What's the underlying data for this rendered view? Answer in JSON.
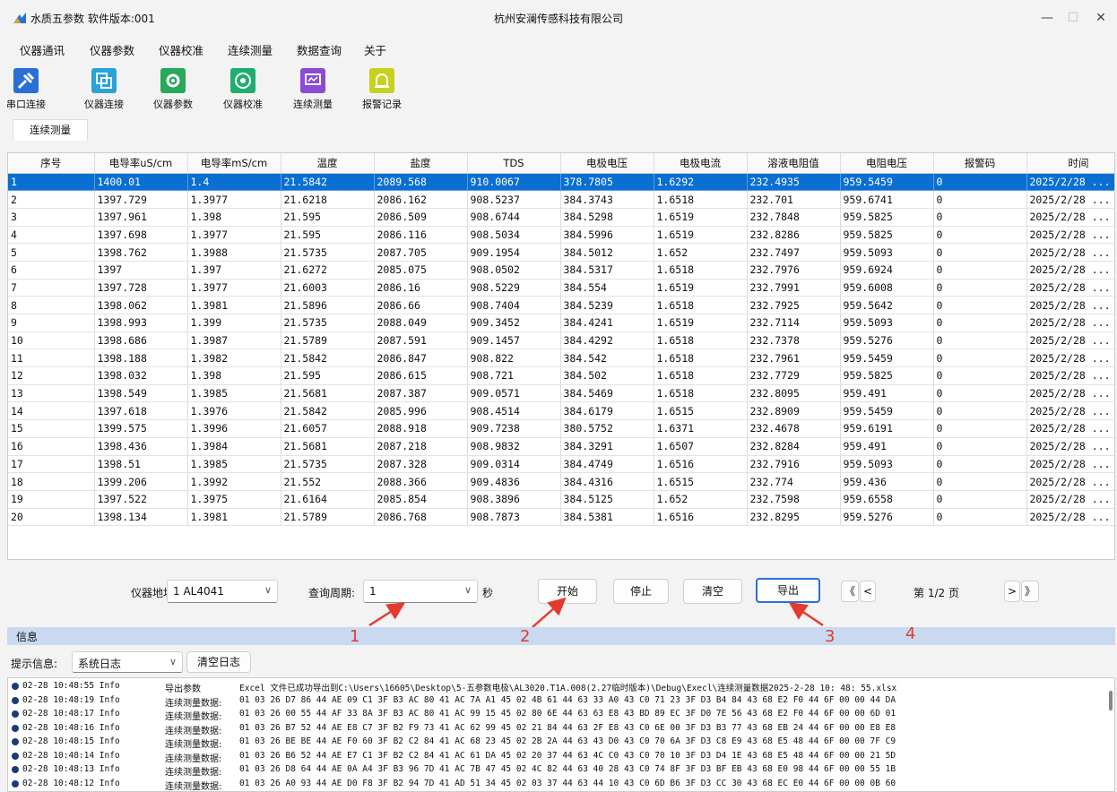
{
  "window": {
    "app_title": "水质五参数  软件版本:001",
    "company": "杭州安澜传感科技有限公司",
    "minimize": "—",
    "maximize": "☐",
    "close": "✕"
  },
  "menu": [
    "仪器通讯",
    "仪器参数",
    "仪器校准",
    "连续测量",
    "数据查询",
    "关于"
  ],
  "toolbar": [
    {
      "label": "串口连接",
      "icon": "plug-icon",
      "color": "#2a6fd6"
    },
    {
      "label": "仪器连接",
      "icon": "link-icon",
      "color": "#2aa3d6"
    },
    {
      "label": "仪器参数",
      "icon": "gear-icon",
      "color": "#28a85a"
    },
    {
      "label": "仪器校准",
      "icon": "target-icon",
      "color": "#1fae70"
    },
    {
      "label": "连续测量",
      "icon": "monitor-icon",
      "color": "#8a4bd6"
    },
    {
      "label": "报警记录",
      "icon": "alarm-icon",
      "color": "#c8d020"
    }
  ],
  "tab": "连续测量",
  "table": {
    "columns": [
      "序号",
      "电导率uS/cm",
      "电导率mS/cm",
      "温度",
      "盐度",
      "TDS",
      "电极电压",
      "电极电流",
      "溶液电阻值",
      "电阻电压",
      "报警码",
      "时间"
    ],
    "rows": [
      [
        "1",
        "1400.01",
        "1.4",
        "21.5842",
        "2089.568",
        "910.0067",
        "378.7805",
        "1.6292",
        "232.4935",
        "959.5459",
        "0",
        "2025/2/28 ..."
      ],
      [
        "2",
        "1397.729",
        "1.3977",
        "21.6218",
        "2086.162",
        "908.5237",
        "384.3743",
        "1.6518",
        "232.701",
        "959.6741",
        "0",
        "2025/2/28 ..."
      ],
      [
        "3",
        "1397.961",
        "1.398",
        "21.595",
        "2086.509",
        "908.6744",
        "384.5298",
        "1.6519",
        "232.7848",
        "959.5825",
        "0",
        "2025/2/28 ..."
      ],
      [
        "4",
        "1397.698",
        "1.3977",
        "21.595",
        "2086.116",
        "908.5034",
        "384.5996",
        "1.6519",
        "232.8286",
        "959.5825",
        "0",
        "2025/2/28 ..."
      ],
      [
        "5",
        "1398.762",
        "1.3988",
        "21.5735",
        "2087.705",
        "909.1954",
        "384.5012",
        "1.652",
        "232.7497",
        "959.5093",
        "0",
        "2025/2/28 ..."
      ],
      [
        "6",
        "1397",
        "1.397",
        "21.6272",
        "2085.075",
        "908.0502",
        "384.5317",
        "1.6518",
        "232.7976",
        "959.6924",
        "0",
        "2025/2/28 ..."
      ],
      [
        "7",
        "1397.728",
        "1.3977",
        "21.6003",
        "2086.16",
        "908.5229",
        "384.554",
        "1.6519",
        "232.7991",
        "959.6008",
        "0",
        "2025/2/28 ..."
      ],
      [
        "8",
        "1398.062",
        "1.3981",
        "21.5896",
        "2086.66",
        "908.7404",
        "384.5239",
        "1.6518",
        "232.7925",
        "959.5642",
        "0",
        "2025/2/28 ..."
      ],
      [
        "9",
        "1398.993",
        "1.399",
        "21.5735",
        "2088.049",
        "909.3452",
        "384.4241",
        "1.6519",
        "232.7114",
        "959.5093",
        "0",
        "2025/2/28 ..."
      ],
      [
        "10",
        "1398.686",
        "1.3987",
        "21.5789",
        "2087.591",
        "909.1457",
        "384.4292",
        "1.6518",
        "232.7378",
        "959.5276",
        "0",
        "2025/2/28 ..."
      ],
      [
        "11",
        "1398.188",
        "1.3982",
        "21.5842",
        "2086.847",
        "908.822",
        "384.542",
        "1.6518",
        "232.7961",
        "959.5459",
        "0",
        "2025/2/28 ..."
      ],
      [
        "12",
        "1398.032",
        "1.398",
        "21.595",
        "2086.615",
        "908.721",
        "384.502",
        "1.6518",
        "232.7729",
        "959.5825",
        "0",
        "2025/2/28 ..."
      ],
      [
        "13",
        "1398.549",
        "1.3985",
        "21.5681",
        "2087.387",
        "909.0571",
        "384.5469",
        "1.6518",
        "232.8095",
        "959.491",
        "0",
        "2025/2/28 ..."
      ],
      [
        "14",
        "1397.618",
        "1.3976",
        "21.5842",
        "2085.996",
        "908.4514",
        "384.6179",
        "1.6515",
        "232.8909",
        "959.5459",
        "0",
        "2025/2/28 ..."
      ],
      [
        "15",
        "1399.575",
        "1.3996",
        "21.6057",
        "2088.918",
        "909.7238",
        "380.5752",
        "1.6371",
        "232.4678",
        "959.6191",
        "0",
        "2025/2/28 ..."
      ],
      [
        "16",
        "1398.436",
        "1.3984",
        "21.5681",
        "2087.218",
        "908.9832",
        "384.3291",
        "1.6507",
        "232.8284",
        "959.491",
        "0",
        "2025/2/28 ..."
      ],
      [
        "17",
        "1398.51",
        "1.3985",
        "21.5735",
        "2087.328",
        "909.0314",
        "384.4749",
        "1.6516",
        "232.7916",
        "959.5093",
        "0",
        "2025/2/28 ..."
      ],
      [
        "18",
        "1399.206",
        "1.3992",
        "21.552",
        "2088.366",
        "909.4836",
        "384.4316",
        "1.6515",
        "232.774",
        "959.436",
        "0",
        "2025/2/28 ..."
      ],
      [
        "19",
        "1397.522",
        "1.3975",
        "21.6164",
        "2085.854",
        "908.3896",
        "384.5125",
        "1.652",
        "232.7598",
        "959.6558",
        "0",
        "2025/2/28 ..."
      ],
      [
        "20",
        "1398.134",
        "1.3981",
        "21.5789",
        "2086.768",
        "908.7873",
        "384.5381",
        "1.6516",
        "232.8295",
        "959.5276",
        "0",
        "2025/2/28 ..."
      ]
    ]
  },
  "controls": {
    "addr_label": "仪器地址:",
    "addr_value": "1 AL4041",
    "period_label": "查询周期:",
    "period_value": "1",
    "period_unit": "秒",
    "start": "开始",
    "stop": "停止",
    "clear": "清空",
    "export": "导出",
    "first": "《",
    "prev": "<",
    "page": "第 1/2 页",
    "next": ">",
    "last": "》"
  },
  "annotations": [
    "1",
    "2",
    "3",
    "4"
  ],
  "info": {
    "header": "信息",
    "label": "提示信息:",
    "select": "系统日志",
    "clear": "清空日志"
  },
  "log": [
    {
      "t": "02-28 10:48:55 Info",
      "k": "导出参数",
      "m": "Excel 文件已成功导出到C:\\Users\\16605\\Desktop\\5-五参数电极\\AL3020.T1A.008(2.27临时版本)\\Debug\\Execl\\连续测量数据2025-2-28  10: 48: 55.xlsx"
    },
    {
      "t": "02-28 10:48:19 Info",
      "k": "连续测量数据:",
      "m": "01 03 26 D7 86 44 AE 09 C1 3F B3 AC 80 41 AC 7A A1 45 02 4B 61 44 63 33 A0 43 C0 71 23 3F D3 B4 84 43 68 E2 F0 44 6F 00 00 44 DA"
    },
    {
      "t": "02-28 10:48:17 Info",
      "k": "连续测量数据:",
      "m": "01 03 26 00 55 44 AF 33 8A 3F B3 AC 80 41 AC 99 15 45 02 80 6E 44 63 63 E8 43 BD 89 EC 3F D0 7E 56 43 68 E2 F0 44 6F 00 00 6D 01"
    },
    {
      "t": "02-28 10:48:16 Info",
      "k": "连续测量数据:",
      "m": "01 03 26 B7 52 44 AE E8 C7 3F B2 F9 73 41 AC 62 99 45 02 21 84 44 63 2F E8 43 C0 6E 00 3F D3 B3 77 43 68 EB 24 44 6F 00 00 E8 E8"
    },
    {
      "t": "02-28 10:48:15 Info",
      "k": "连续测量数据:",
      "m": "01 03 26 BE BE 44 AE F0 60 3F B2 C2 84 41 AC 68 23 45 02 2B 2A 44 63 43 D0 43 C0 70 6A 3F D3 C8 E9 43 68 E5 48 44 6F 00 00 7F C9"
    },
    {
      "t": "02-28 10:48:14 Info",
      "k": "连续测量数据:",
      "m": "01 03 26 B6 52 44 AE E7 C1 3F B2 C2 84 41 AC 61 DA 45 02 20 37 44 63 4C C0 43 C0 70 10 3F D3 D4 1E 43 68 E5 48 44 6F 00 00 21 5D"
    },
    {
      "t": "02-28 10:48:13 Info",
      "k": "连续测量数据:",
      "m": "01 03 26 D8 64 44 AE 0A A4 3F B3 96 7D 41 AC 7B 47 45 02 4C 82 44 63 40 28 43 C0 74 8F 3F D3 BF EB 43 68 E0 98 44 6F 00 00 55 1B"
    },
    {
      "t": "02-28 10:48:12 Info",
      "k": "连续测量数据:",
      "m": "01 03 26 A0 93 44 AE D0 F8 3F B2 94 7D 41 AD 51 34 45 02 03 37 44 63 44 10 43 C0 6D B6 3F D3 CC 30 43 68 EC E0 44 6F 00 00 0B 60"
    }
  ]
}
